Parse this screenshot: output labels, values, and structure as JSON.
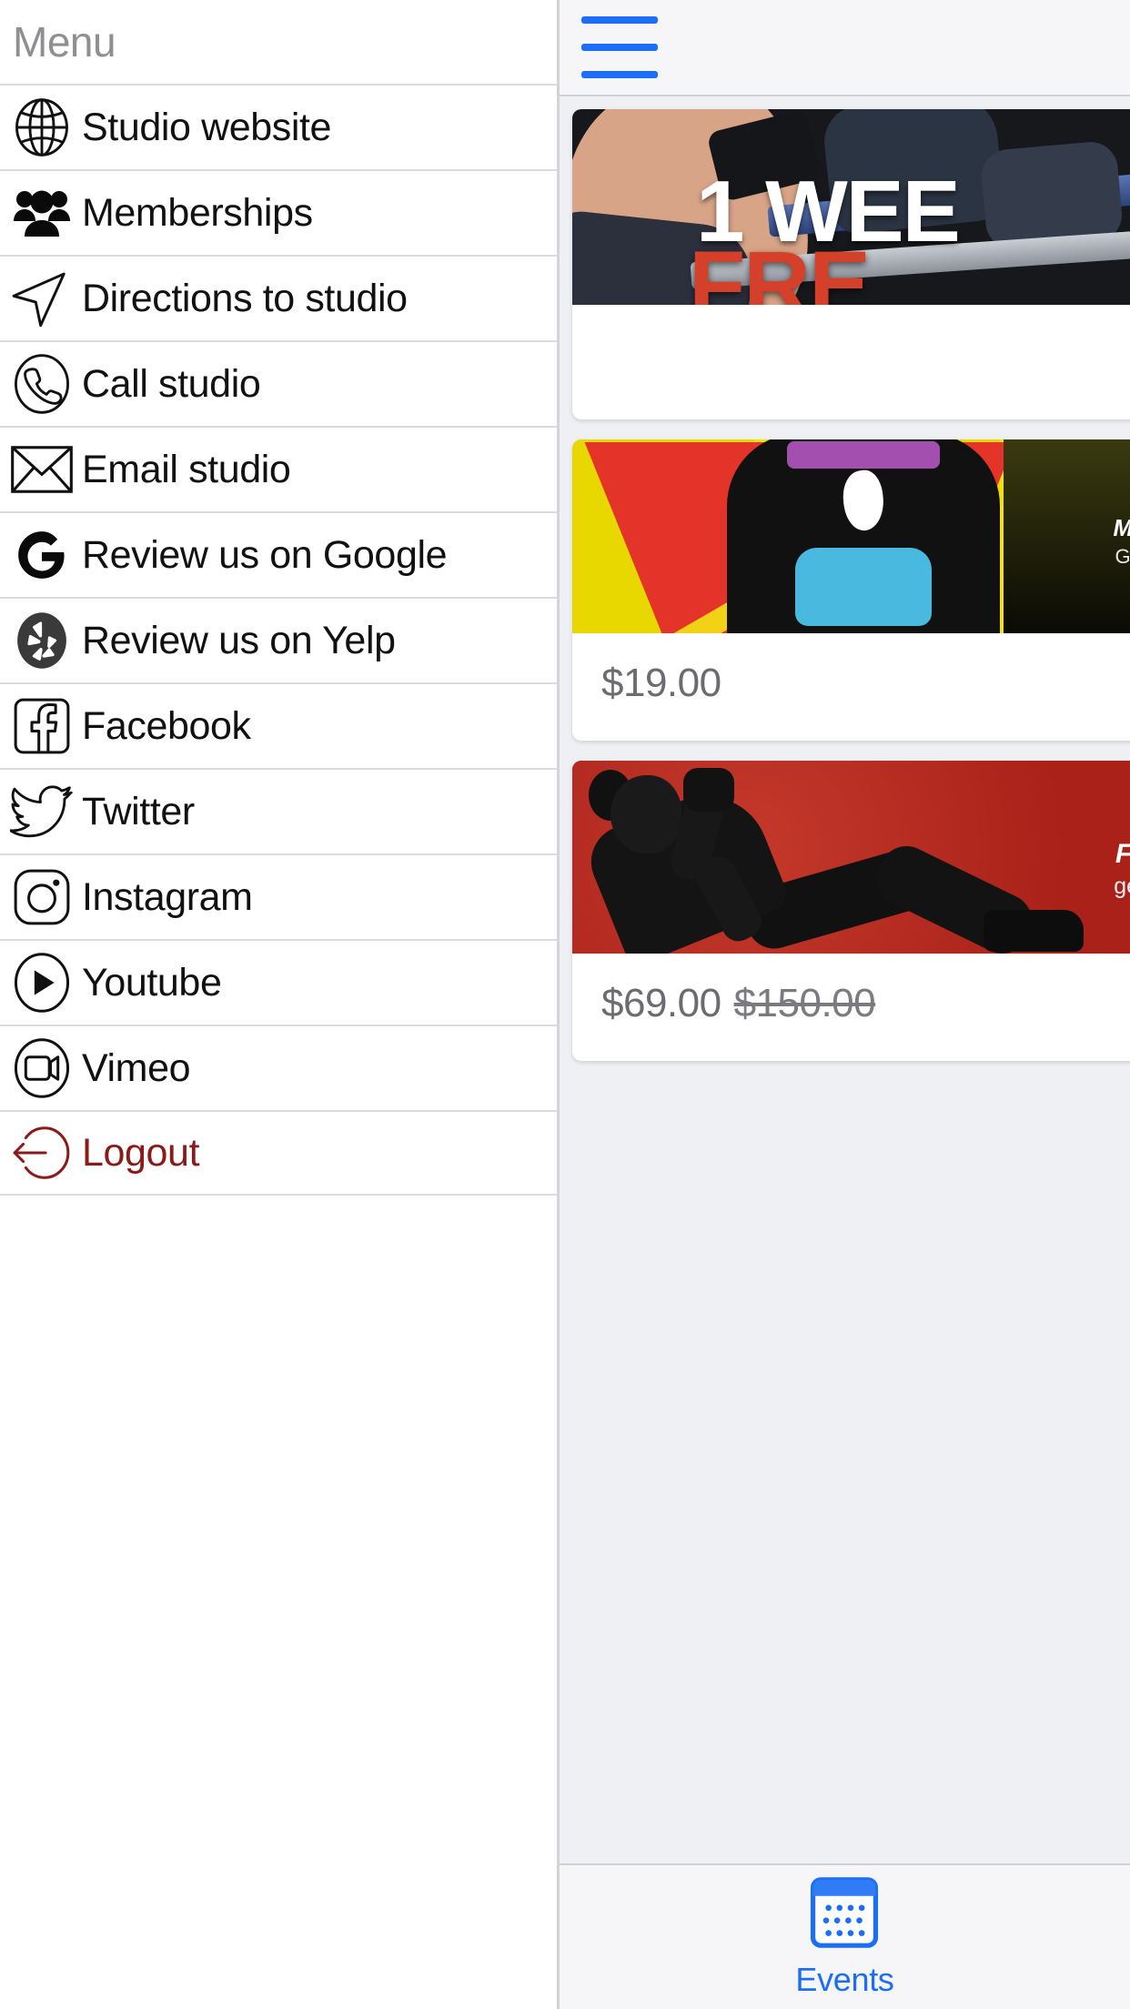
{
  "drawer": {
    "title": "Menu",
    "items": [
      {
        "label": "Studio website",
        "icon": "globe-icon",
        "color": "#111111"
      },
      {
        "label": "Memberships",
        "icon": "people-icon",
        "color": "#111111"
      },
      {
        "label": "Directions to studio",
        "icon": "navigate-icon",
        "color": "#111111"
      },
      {
        "label": "Call studio",
        "icon": "phone-icon",
        "color": "#111111"
      },
      {
        "label": "Email studio",
        "icon": "envelope-icon",
        "color": "#111111"
      },
      {
        "label": "Review us on Google",
        "icon": "google-icon",
        "color": "#111111"
      },
      {
        "label": "Review us on Yelp",
        "icon": "yelp-icon",
        "color": "#111111"
      },
      {
        "label": "Facebook",
        "icon": "facebook-icon",
        "color": "#111111"
      },
      {
        "label": "Twitter",
        "icon": "twitter-icon",
        "color": "#111111"
      },
      {
        "label": "Instagram",
        "icon": "instagram-icon",
        "color": "#111111"
      },
      {
        "label": "Youtube",
        "icon": "youtube-icon",
        "color": "#111111"
      },
      {
        "label": "Vimeo",
        "icon": "vimeo-icon",
        "color": "#111111"
      },
      {
        "label": "Logout",
        "icon": "logout-icon",
        "color": "#8b1a1a"
      }
    ]
  },
  "content": {
    "menu_toggle": "hamburger-icon",
    "accent_color": "#1b6ef5",
    "cards": [
      {
        "image_alt": "1 WEEK FREE gym promotion",
        "image_text_line1": "1 WEE",
        "image_text_line2": "FRE",
        "price": "",
        "old_price": ""
      },
      {
        "image_alt": "Boxer poster with yellow background",
        "image_text_line1": "Mu",
        "image_text_line2": "Get",
        "price": "$19.00",
        "old_price": ""
      },
      {
        "image_alt": "Fitness woman on red background",
        "image_text_line1": "Fit",
        "image_text_line2": "get",
        "price": "$69.00",
        "old_price": "$150.00"
      }
    ]
  },
  "tabbar": {
    "tabs": [
      {
        "label": "Events",
        "icon": "calendar-icon",
        "active": true
      }
    ]
  }
}
